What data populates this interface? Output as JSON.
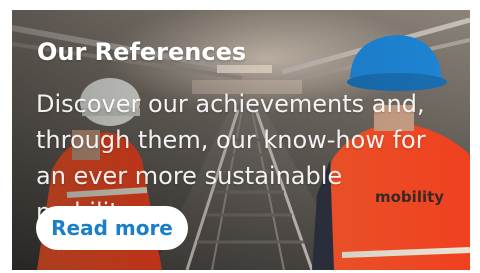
{
  "card": {
    "title": "Our References",
    "body": "Discover our achievements and, through them, our know-how for an ever more sustainable mobility.",
    "cta_label": "Read more",
    "vest_text": "mobility",
    "accent_color": "#1a7fc8"
  }
}
